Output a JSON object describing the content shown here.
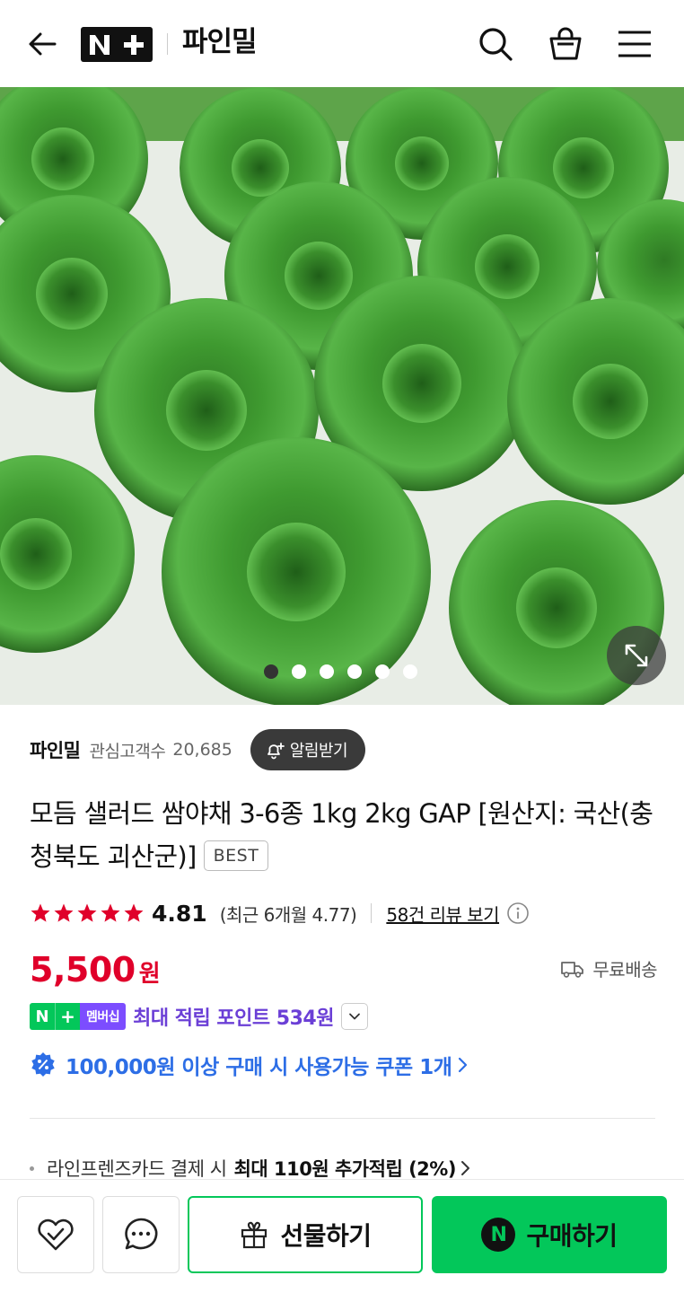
{
  "header": {
    "store_name": "파인밀",
    "icons": [
      "back-arrow-icon",
      "n-plus-logo",
      "search-icon",
      "shopping-bag-icon",
      "hamburger-menu-icon"
    ]
  },
  "gallery": {
    "image_count": 6,
    "active_index": 0,
    "image_subject": "romaine lettuce heads",
    "zoom_icon": "expand-icon"
  },
  "seller": {
    "name": "파인밀",
    "follower_label": "관심고객수",
    "follower_count": "20,685",
    "notify_label": "알림받기"
  },
  "product": {
    "title": "모듬 샐러드 쌈야채 3-6종 1kg 2kg GAP [원산지: 국산(충청북도 괴산군)]",
    "badge": "BEST"
  },
  "rating": {
    "stars": 5,
    "score": "4.81",
    "recent": "(최근 6개월 4.77)",
    "review_link": "58건 리뷰 보기"
  },
  "price": {
    "amount": "5,500",
    "unit": "원",
    "shipping": "무료배송"
  },
  "membership": {
    "badge_n": "N",
    "badge_plus": "+",
    "badge_text": "멤버십",
    "points": "최대 적립 포인트 534원"
  },
  "coupon": {
    "text": "100,000원 이상 구매 시 사용가능 쿠폰 1개"
  },
  "card_benefit": {
    "text": "라인프렌즈카드 결제 시",
    "strong": "최대 110원 추가적립 (2%)"
  },
  "bottom_bar": {
    "gift_label": "선물하기",
    "buy_label": "구매하기",
    "buy_badge": "N"
  },
  "colors": {
    "accent_green": "#03c75a",
    "price_red": "#e0002a",
    "membership_purple": "#6b3fd6",
    "coupon_blue": "#2d6ee6",
    "star_red": "#e0002a"
  }
}
